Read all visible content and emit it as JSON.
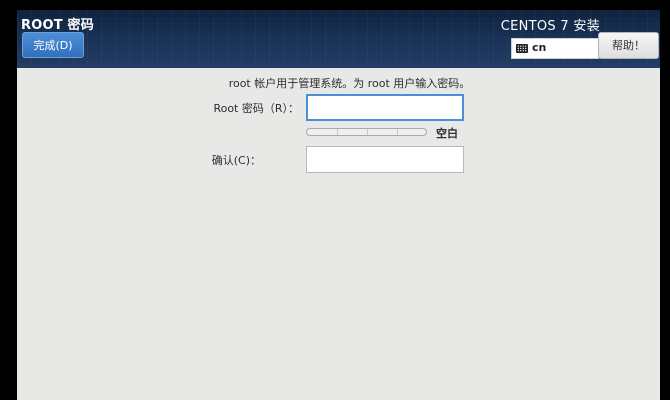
{
  "header": {
    "spoke_title": "ROOT 密码",
    "done_button_label": "完成(D)",
    "product_title": "CENTOS 7 安装",
    "keyboard_layout": "cn",
    "help_button_label": "帮助！"
  },
  "form": {
    "intro_text": "root 帐户用于管理系统。为 root 用户输入密码。",
    "password_label": "Root 密码（R）：",
    "password_value": "",
    "strength_level": 0,
    "strength_text": "空白",
    "confirm_label": "确认(C)：",
    "confirm_value": ""
  },
  "icons": {
    "keyboard": "keyboard-icon"
  }
}
